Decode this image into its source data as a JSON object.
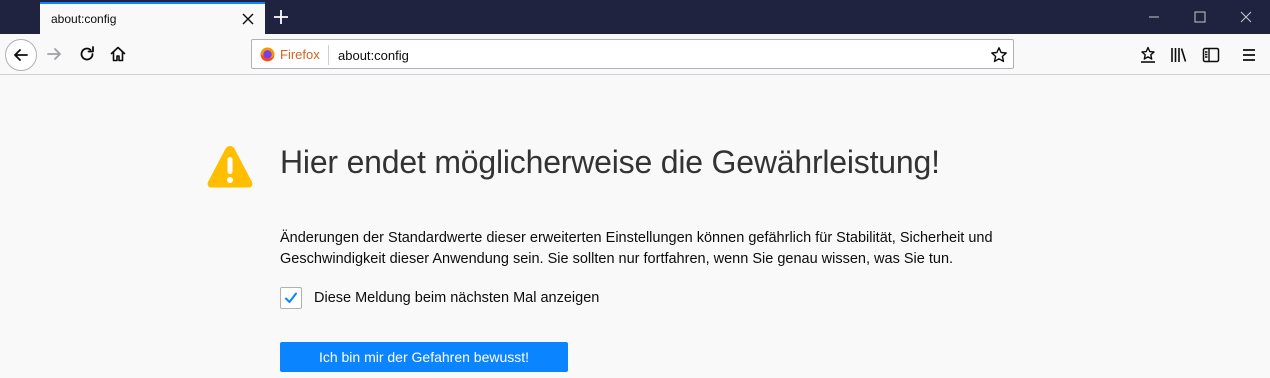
{
  "browser": {
    "tab": {
      "title": "about:config"
    },
    "urlbar": {
      "identity_label": "Firefox",
      "url": "about:config"
    },
    "colors": {
      "titlebar": "#202340",
      "accent": "#0a84ff",
      "warning": "#ffbf00",
      "identity": "#d7621a"
    }
  },
  "page": {
    "headline": "Hier endet möglicherweise die Gewährleistung!",
    "description": "Änderungen der Standardwerte dieser erweiterten Einstellungen können gefährlich für Stabilität, Sicherheit und Geschwindigkeit dieser Anwendung sein. Sie sollten nur fortfahren, wenn Sie genau wissen, was Sie tun.",
    "checkbox": {
      "label": "Diese Meldung beim nächsten Mal anzeigen",
      "checked": true
    },
    "accept_button": "Ich bin mir der Gefahren bewusst!"
  },
  "icons": {
    "tab_close": "close-icon",
    "new_tab": "plus-icon",
    "minimize": "minimize-icon",
    "maximize": "maximize-icon",
    "close_window": "close-icon",
    "back": "back-arrow-icon",
    "forward": "forward-arrow-icon",
    "reload": "reload-icon",
    "home": "home-icon",
    "bookmark": "star-icon",
    "bookmarks_toolbar": "star-tray-icon",
    "library": "library-icon",
    "sidebar": "sidebar-icon",
    "menu": "hamburger-icon",
    "warning": "warning-icon",
    "firefox": "firefox-icon"
  }
}
